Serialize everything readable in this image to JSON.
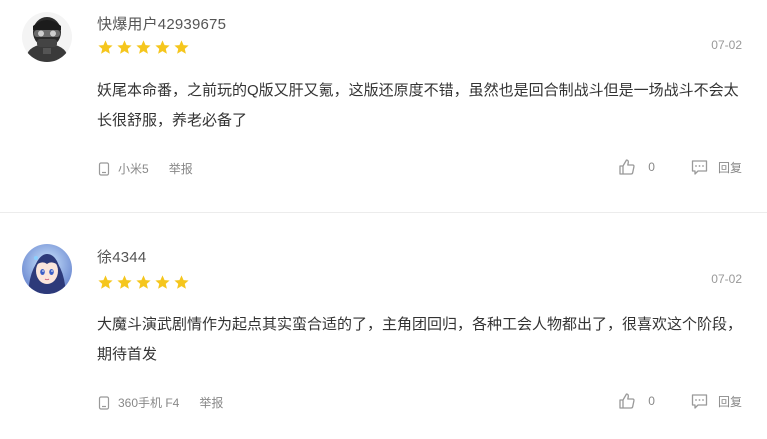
{
  "colors": {
    "star": "#f5c61d",
    "divider": "#ececec",
    "muted": "#888888"
  },
  "reviews": [
    {
      "username": "快爆用户42939675",
      "rating": 5,
      "date": "07-02",
      "content": "妖尾本命番，之前玩的Q版又肝又氪，这版还原度不错，虽然也是回合制战斗但是一场战斗不会太长很舒服，养老必备了",
      "device": "小米5",
      "report_label": "举报",
      "likes": "0",
      "reply_label": "回复",
      "avatar_icon": "masked-soldier-avatar"
    },
    {
      "username": "徐4344",
      "rating": 5,
      "date": "07-02",
      "content": "大魔斗演武剧情作为起点其实蛮合适的了，主角团回归，各种工会人物都出了，很喜欢这个阶段，期待首发",
      "device": "360手机 F4",
      "report_label": "举报",
      "likes": "0",
      "reply_label": "回复",
      "avatar_icon": "anime-girl-avatar"
    }
  ]
}
